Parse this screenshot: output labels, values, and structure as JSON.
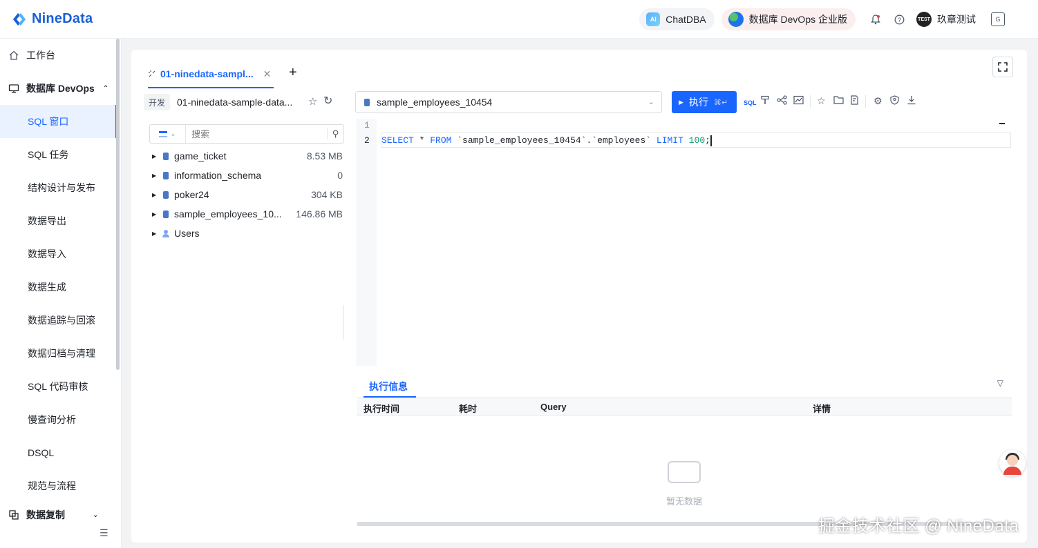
{
  "header": {
    "logo_text": "NineData",
    "chat_label": "ChatDBA",
    "chat_badge": "AI",
    "devops_label": "数据库 DevOps 企业版",
    "avatar_text": "TEST",
    "user_name": "玖章测试",
    "lang_icon_text": "G",
    "brand_color": "#1a5fd8"
  },
  "sidebar": {
    "items": [
      {
        "label": "工作台",
        "icon": "home-icon"
      },
      {
        "label": "数据库 DevOps",
        "icon": "monitor-icon"
      },
      {
        "label": "SQL 窗口",
        "active": true
      },
      {
        "label": "SQL 任务"
      },
      {
        "label": "结构设计与发布"
      },
      {
        "label": "数据导出"
      },
      {
        "label": "数据导入"
      },
      {
        "label": "数据生成"
      },
      {
        "label": "数据追踪与回滚"
      },
      {
        "label": "数据归档与清理"
      },
      {
        "label": "SQL 代码审核"
      },
      {
        "label": "慢查询分析"
      },
      {
        "label": "DSQL"
      },
      {
        "label": "规范与流程"
      },
      {
        "label": "数据复制",
        "icon": "replication-icon"
      }
    ],
    "accent_color": "#1966ff"
  },
  "tab": {
    "label": "01-ninedata-sampl..."
  },
  "connection": {
    "env_badge": "开发",
    "name": "01-ninedata-sample-data..."
  },
  "tree": {
    "search_placeholder": "搜索",
    "items": [
      {
        "name": "game_ticket",
        "size": "8.53 MB",
        "type": "database"
      },
      {
        "name": "information_schema",
        "size": "0",
        "type": "database"
      },
      {
        "name": "poker24",
        "size": "304 KB",
        "type": "database"
      },
      {
        "name": "sample_employees_10...",
        "size": "146.86 MB",
        "type": "database"
      },
      {
        "name": "Users",
        "size": "",
        "type": "users"
      }
    ]
  },
  "editor": {
    "selected_db": "sample_employees_10454",
    "run_label": "执行",
    "run_shortcut": "⌘↵",
    "sql_tool_label": "SQL",
    "line_numbers": [
      "1",
      "2"
    ],
    "sql": {
      "kw_select": "SELECT",
      "star": " * ",
      "kw_from": "FROM",
      "table": " `sample_employees_10454`.`employees` ",
      "kw_limit": "LIMIT",
      "limit_value": "100",
      "end": ";"
    }
  },
  "results": {
    "tab_label": "执行信息",
    "columns": [
      "执行时间",
      "耗时",
      "Query",
      "详情"
    ],
    "empty_text": "暂无数据"
  },
  "watermark": "掘金技术社区 @ NineData"
}
